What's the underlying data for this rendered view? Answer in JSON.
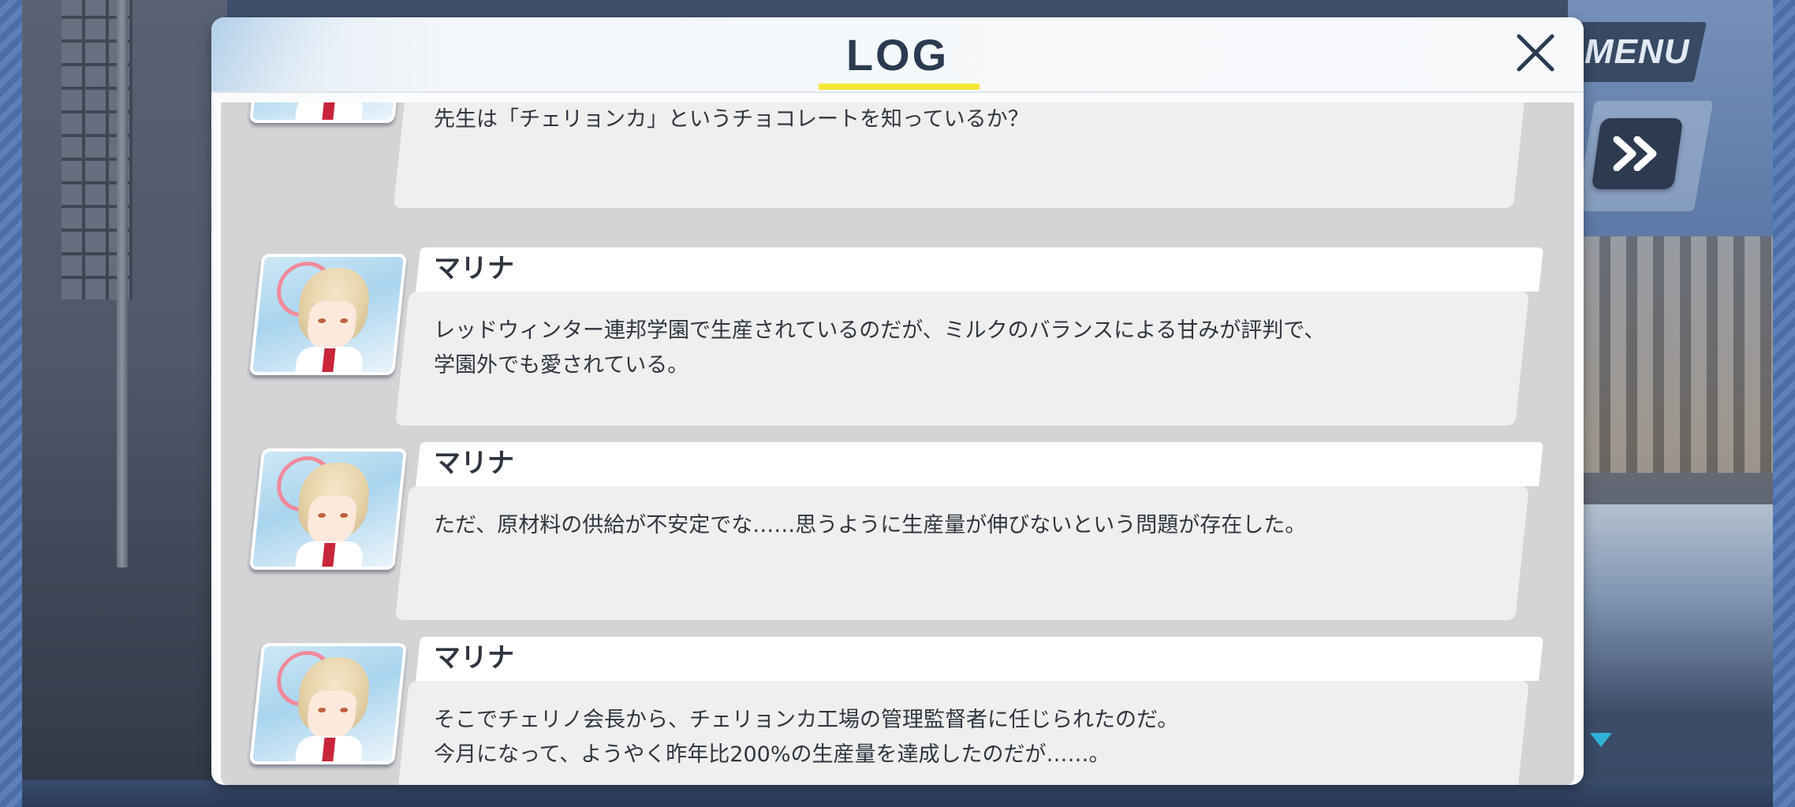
{
  "header": {
    "title": "LOG",
    "underline_color": "#f5e63a"
  },
  "hud": {
    "menu_label": "MENU",
    "skip_icon": "fast-forward-icon",
    "scroll_indicator_icon": "triangle-down-icon"
  },
  "entries": [
    {
      "speaker": "",
      "text": "先生は「チェリョンカ」というチョコレートを知っているか？"
    },
    {
      "speaker": "マリナ",
      "text": "レッドウィンター連邦学園で生産されているのだが、ミルクのバランスによる甘みが評判で、\n学園外でも愛されている。"
    },
    {
      "speaker": "マリナ",
      "text": "ただ、原材料の供給が不安定でな……思うように生産量が伸びないという問題が存在した。"
    },
    {
      "speaker": "マリナ",
      "text": "そこでチェリノ会長から、チェリョンカ工場の管理監督者に任じられたのだ。\n今月になって、ようやく昨年比200%の生産量を達成したのだが……。"
    }
  ],
  "colors": {
    "panel_bg": "#fafbfc",
    "title_text": "#2b3a50",
    "bubble_bg": "#efefef",
    "accent_yellow": "#f5e63a",
    "indicator_cyan": "#2fb4d8"
  }
}
